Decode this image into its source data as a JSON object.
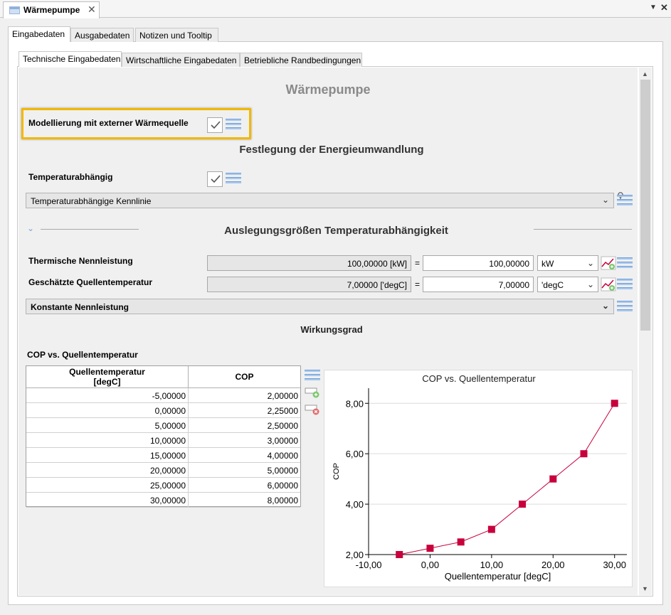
{
  "window": {
    "tab_title": "Wärmepumpe",
    "close": "✕",
    "menu_glyph": "▼",
    "window_close": "✕"
  },
  "outer_tabs": [
    "Eingabedaten",
    "Ausgabedaten",
    "Notizen und Tooltip"
  ],
  "inner_tabs": [
    "Technische Eingabedaten",
    "Wirtschaftliche Eingabedaten",
    "Betriebliche Randbedingungen"
  ],
  "page": {
    "title": "Wärmepumpe",
    "external_source_label": "Modellierung mit externer Wärmequelle",
    "energy_heading": "Festlegung der Energieumwandlung",
    "temperature_dependent_label": "Temperaturabhängig",
    "characteristic_dropdown": "Temperaturabhängige Kennlinie",
    "design_heading": "Auslegungsgrößen Temperaturabhängigkeit",
    "rows": [
      {
        "label": "Thermische Nennleistung",
        "readonly": "100,00000 [kW]",
        "eq": "=",
        "value": "100,00000",
        "unit": "kW"
      },
      {
        "label": "Geschätzte Quellentemperatur",
        "readonly": "7,00000 ['degC]",
        "eq": "=",
        "value": "7,00000",
        "unit": "'degC"
      }
    ],
    "mode_dropdown": "Konstante Nennleistung",
    "efficiency_heading": "Wirkungsgrad",
    "table_title": "COP vs. Quellentemperatur",
    "table": {
      "headers": [
        "Quellentemperatur\n[degC]",
        "COP"
      ],
      "rows": [
        [
          "-5,00000",
          "2,00000"
        ],
        [
          "0,00000",
          "2,25000"
        ],
        [
          "5,00000",
          "2,50000"
        ],
        [
          "10,00000",
          "3,00000"
        ],
        [
          "15,00000",
          "4,00000"
        ],
        [
          "20,00000",
          "5,00000"
        ],
        [
          "25,00000",
          "6,00000"
        ],
        [
          "30,00000",
          "8,00000"
        ]
      ]
    }
  },
  "colors": {
    "series": "#c8003c",
    "highlight": "#f2b800",
    "menu_icon": "#a8c8ee"
  },
  "chart_data": {
    "type": "line",
    "title": "COP vs. Quellentemperatur",
    "xlabel": "Quellentemperatur [degC]",
    "ylabel": "COP",
    "x": [
      -5,
      0,
      5,
      10,
      15,
      20,
      25,
      30
    ],
    "series": [
      {
        "values": [
          2,
          2.25,
          2.5,
          3,
          4,
          5,
          6,
          8
        ]
      }
    ],
    "xlim": [
      -10,
      32
    ],
    "ylim": [
      2,
      8.6
    ],
    "xticks": [
      "-10,00",
      "0,00",
      "10,00",
      "20,00",
      "30,00"
    ],
    "yticks": [
      "2,00",
      "4,00",
      "6,00",
      "8,00"
    ],
    "grid": true,
    "marker": "square"
  }
}
